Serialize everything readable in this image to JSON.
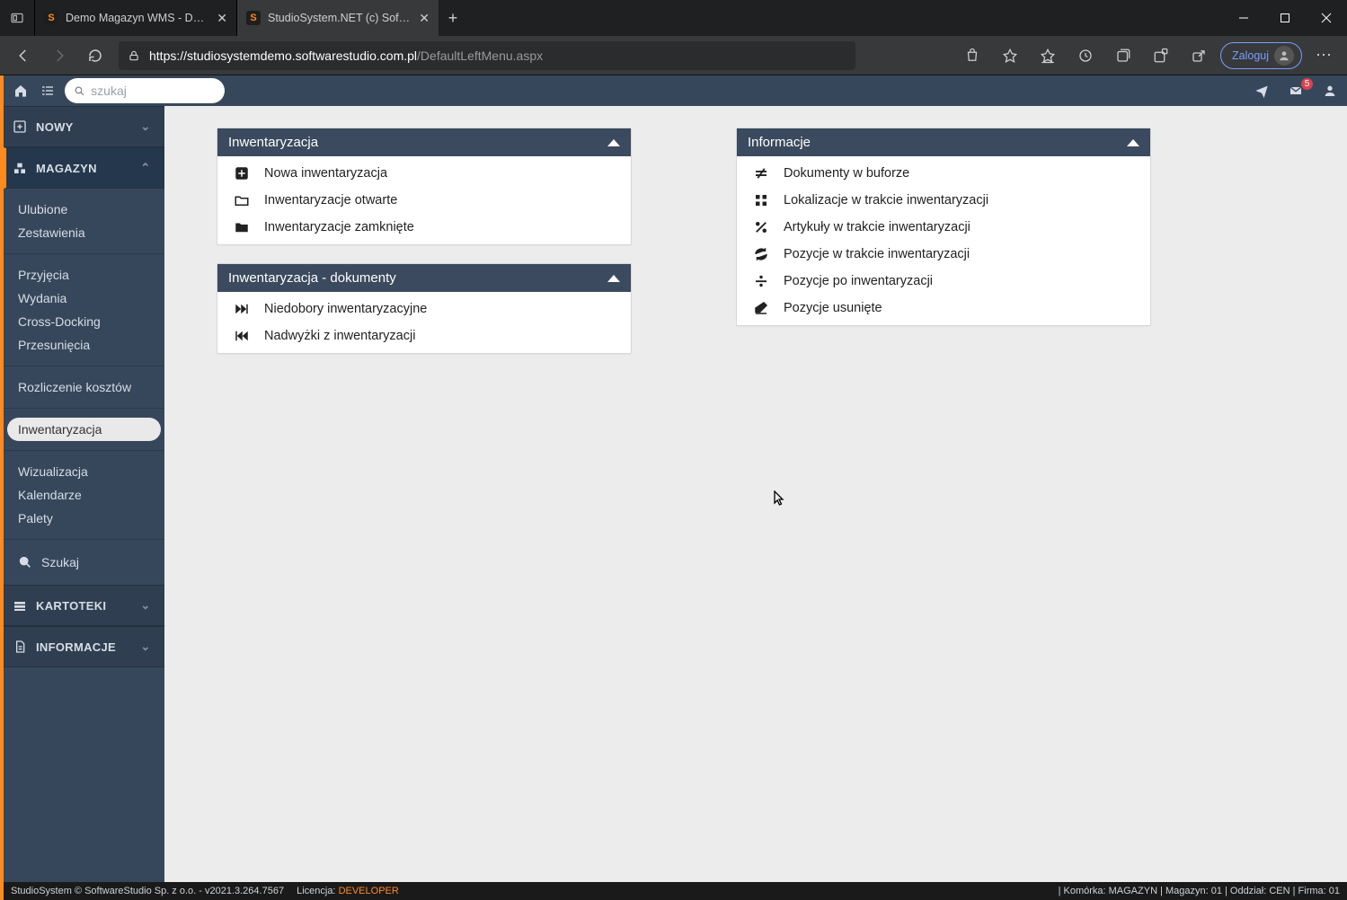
{
  "browser": {
    "tabs": [
      {
        "title": "Demo Magazyn WMS - Demo o…",
        "favicon": "S"
      },
      {
        "title": "StudioSystem.NET (c) SoftwareSt…",
        "favicon": "S"
      }
    ],
    "url_host": "https://studiosystemdemo.softwarestudio.com.pl",
    "url_path": "/DefaultLeftMenu.aspx",
    "login_label": "Zaloguj"
  },
  "topbar": {
    "search_placeholder": "szukaj",
    "mail_badge": "5"
  },
  "sidebar": {
    "cats": {
      "nowy": "NOWY",
      "magazyn": "MAGAZYN",
      "kartoteki": "KARTOTEKI",
      "informacje": "INFORMACJE"
    },
    "magazyn_items_g1": [
      "Ulubione",
      "Zestawienia"
    ],
    "magazyn_items_g2": [
      "Przyjęcia",
      "Wydania",
      "Cross-Docking",
      "Przesunięcia"
    ],
    "magazyn_items_g3": [
      "Rozliczenie kosztów"
    ],
    "magazyn_items_g4": [
      "Inwentaryzacja"
    ],
    "magazyn_items_g5": [
      "Wizualizacja",
      "Kalendarze",
      "Palety"
    ],
    "magazyn_search": "Szukaj"
  },
  "panels": {
    "inwentaryzacja": {
      "title": "Inwentaryzacja",
      "items": [
        "Nowa inwentaryzacja",
        "Inwentaryzacje otwarte",
        "Inwentaryzacje zamknięte"
      ]
    },
    "dokumenty": {
      "title": "Inwentaryzacja - dokumenty",
      "items": [
        "Niedobory inwentaryzacyjne",
        "Nadwyżki z inwentaryzacji"
      ]
    },
    "informacje": {
      "title": "Informacje",
      "items": [
        "Dokumenty w buforze",
        "Lokalizacje w trakcie inwentaryzacji",
        "Artykuły w trakcie inwentaryzacji",
        "Pozycje w trakcie inwentaryzacji",
        "Pozycje po inwentaryzacji",
        "Pozycje usunięte"
      ]
    }
  },
  "status": {
    "left1": "StudioSystem © SoftwareStudio Sp. z o.o. - v2021.3.264.7567",
    "lic_label": "Licencja:",
    "lic_value": "DEVELOPER",
    "right": "| Komórka: MAGAZYN | Magazyn: 01 | Oddział: CEN | Firma: 01"
  }
}
